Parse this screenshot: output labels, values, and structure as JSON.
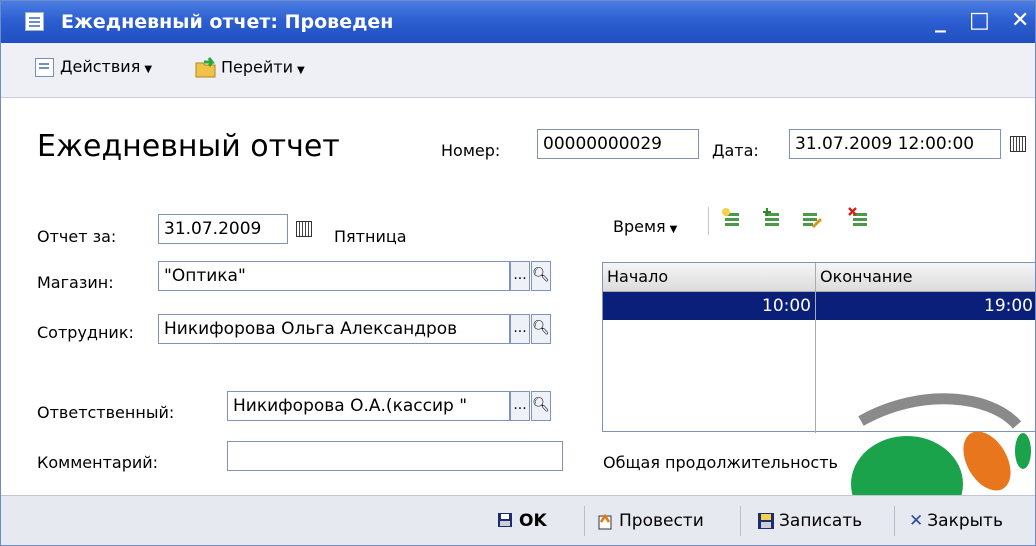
{
  "window": {
    "title": "Ежедневный отчет: Проведен",
    "controls": {
      "minimize": "_",
      "maximize": "□",
      "close": "✕"
    }
  },
  "toolbar": {
    "actions_label": "Действия",
    "goto_label": "Перейти"
  },
  "form": {
    "heading": "Ежедневный отчет",
    "number_label": "Номер:",
    "number_value": "00000000029",
    "date_label": "Дата:",
    "date_value": "31.07.2009 12:00:00",
    "report_for_label": "Отчет за:",
    "report_for_value": "31.07.2009",
    "weekday": "Пятница",
    "store_label": "Магазин:",
    "store_value": "\"Оптика\"",
    "employee_label": "Сотрудник:",
    "employee_value": "Никифорова Ольга Александров",
    "responsible_label": "Ответственный:",
    "responsible_value": "Никифорова О.А.(кассир \"",
    "comment_label": "Комментарий:",
    "comment_value": "",
    "ellipsis": "...",
    "time_menu_label": "Время",
    "grid": {
      "columns": [
        "Начало",
        "Окончание"
      ],
      "rows": [
        [
          "10:00",
          "19:00"
        ]
      ]
    },
    "total_label": "Общая продолжительность"
  },
  "bottom": {
    "ok_label": "OK",
    "post_label": "Провести",
    "save_label": "Записать",
    "close_label": "Закрыть"
  },
  "colors": {
    "title_bar": "#2d5fd2",
    "selection": "#0a1f7a",
    "logo_green": "#1aa34a",
    "logo_orange": "#e8761c",
    "logo_gray": "#8a8a8a"
  }
}
